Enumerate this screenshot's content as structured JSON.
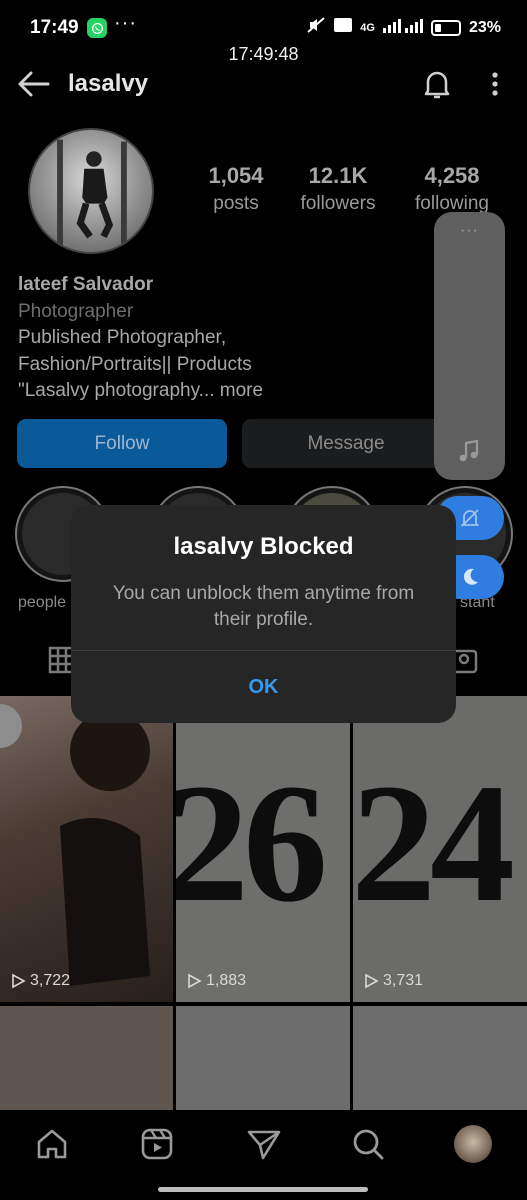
{
  "status_bar": {
    "time": "17:49",
    "overflow": "···",
    "network": "4G",
    "battery": "23%",
    "overlay_clock": "17:49:48"
  },
  "header": {
    "username": "lasalvy",
    "icons": [
      "back-arrow-icon",
      "bell-icon",
      "kebab-menu-icon"
    ]
  },
  "profile": {
    "stats": [
      {
        "value": "1,054",
        "label": "posts"
      },
      {
        "value": "12.1K",
        "label": "followers"
      },
      {
        "value": "4,258",
        "label": "following"
      }
    ],
    "name": "lateef Salvador",
    "category": "Photographer",
    "bio_lines": [
      "Published Photographer,",
      "Fashion/Portraits|| Products",
      "\"Lasalvy photography... more"
    ],
    "follow_label": "Follow",
    "message_label": "Message"
  },
  "highlights": {
    "first_label": "people",
    "last_label": "stant"
  },
  "posts": [
    {
      "views": "3,722"
    },
    {
      "views": "1,883",
      "overlay_text": "26"
    },
    {
      "views": "3,731",
      "overlay_text": "24"
    }
  ],
  "dialog": {
    "title": "lasalvy Blocked",
    "message": "You can unblock them anytime from their profile.",
    "ok_label": "OK"
  },
  "side_panel": {
    "dots": "···"
  },
  "colors": {
    "follow_button": "#0a5a99",
    "dialog_bg": "#262626",
    "ok_blue": "#3797ef",
    "fab_blue": "#2f7de0"
  }
}
